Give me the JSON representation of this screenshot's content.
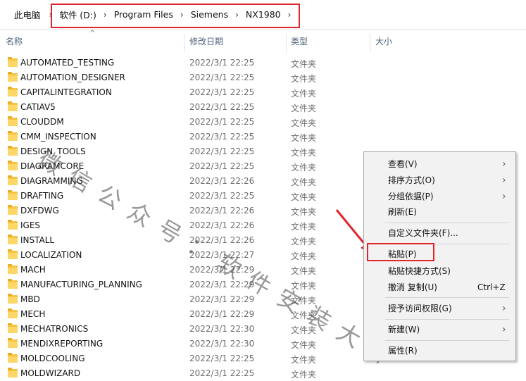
{
  "breadcrumb": {
    "items": [
      "此电脑",
      "软件 (D:)",
      "Program Files",
      "Siemens",
      "NX1980"
    ],
    "highlight_color": "#e0262d"
  },
  "columns": {
    "name": "名称",
    "date": "修改日期",
    "type": "类型",
    "size": "大小"
  },
  "files": [
    {
      "name": "AUTOMATED_TESTING",
      "date": "2022/3/1 22:25",
      "type": "文件夹"
    },
    {
      "name": "AUTOMATION_DESIGNER",
      "date": "2022/3/1 22:25",
      "type": "文件夹"
    },
    {
      "name": "CAPITALINTEGRATION",
      "date": "2022/3/1 22:25",
      "type": "文件夹"
    },
    {
      "name": "CATIAV5",
      "date": "2022/3/1 22:25",
      "type": "文件夹"
    },
    {
      "name": "CLOUDDM",
      "date": "2022/3/1 22:25",
      "type": "文件夹"
    },
    {
      "name": "CMM_INSPECTION",
      "date": "2022/3/1 22:25",
      "type": "文件夹"
    },
    {
      "name": "DESIGN_TOOLS",
      "date": "2022/3/1 22:25",
      "type": "文件夹"
    },
    {
      "name": "DIAGRAMCORE",
      "date": "2022/3/1 22:25",
      "type": "文件夹"
    },
    {
      "name": "DIAGRAMMING",
      "date": "2022/3/1 22:26",
      "type": "文件夹"
    },
    {
      "name": "DRAFTING",
      "date": "2022/3/1 22:25",
      "type": "文件夹"
    },
    {
      "name": "DXFDWG",
      "date": "2022/3/1 22:26",
      "type": "文件夹"
    },
    {
      "name": "IGES",
      "date": "2022/3/1 22:26",
      "type": "文件夹"
    },
    {
      "name": "INSTALL",
      "date": "2022/3/1 22:26",
      "type": "文件夹"
    },
    {
      "name": "LOCALIZATION",
      "date": "2022/3/1 22:27",
      "type": "文件夹"
    },
    {
      "name": "MACH",
      "date": "2022/3/1 22:29",
      "type": "文件夹"
    },
    {
      "name": "MANUFACTURING_PLANNING",
      "date": "2022/3/1 22:29",
      "type": "文件夹"
    },
    {
      "name": "MBD",
      "date": "2022/3/1 22:29",
      "type": "文件夹"
    },
    {
      "name": "MECH",
      "date": "2022/3/1 22:29",
      "type": "文件夹"
    },
    {
      "name": "MECHATRONICS",
      "date": "2022/3/1 22:30",
      "type": "文件夹"
    },
    {
      "name": "MENDIXREPORTING",
      "date": "2022/3/1 22:30",
      "type": "文件夹"
    },
    {
      "name": "MOLDCOOLING",
      "date": "2022/3/1 22:25",
      "type": "文件夹"
    },
    {
      "name": "MOLDWIZARD",
      "date": "2022/3/1 22:25",
      "type": "文件夹"
    }
  ],
  "context_menu": {
    "view": "查看(V)",
    "sort_by": "排序方式(O)",
    "group_by": "分组依据(P)",
    "refresh": "刷新(E)",
    "customize_folder": "自定义文件夹(F)...",
    "paste": "粘贴(P)",
    "paste_shortcut": "粘贴快捷方式(S)",
    "undo_copy": "撤消 复制(U)",
    "undo_shortcut": "Ctrl+Z",
    "give_access": "授予访问权限(G)",
    "new": "新建(W)",
    "properties": "属性(R)"
  },
  "watermark": "微信公众号：软件安装大神",
  "accent_color": "#e0262d"
}
